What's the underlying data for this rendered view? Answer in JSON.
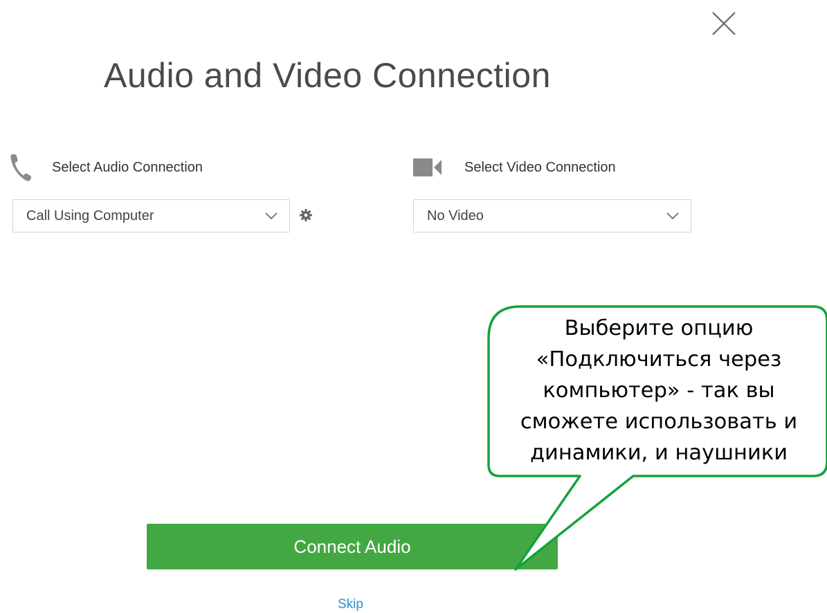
{
  "dialog": {
    "title": "Audio and Video Connection",
    "close_icon": "close-icon"
  },
  "audio": {
    "label": "Select Audio Connection",
    "icon": "phone-icon",
    "selected": "Call Using Computer",
    "settings_icon": "gear-icon"
  },
  "video": {
    "label": "Select Video Connection",
    "icon": "video-camera-icon",
    "selected": "No Video"
  },
  "actions": {
    "connect_label": "Connect Audio",
    "skip_label": "Skip"
  },
  "callout": {
    "lines": [
      "Выберите опцию",
      "«Подключиться через",
      "компьютер» - так вы",
      "сможете использовать и",
      "динамики, и наушники"
    ],
    "border_color": "#13a33b"
  },
  "colors": {
    "primary_button": "#43a843",
    "link": "#2a8fd4",
    "icon_gray": "#888888"
  }
}
